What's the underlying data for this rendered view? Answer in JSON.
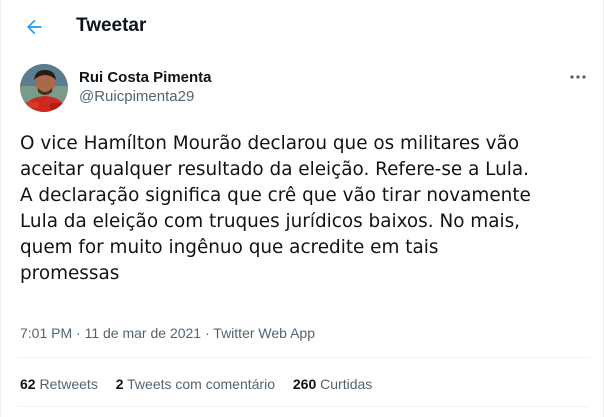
{
  "header": {
    "title": "Tweetar",
    "back_icon": "arrow-left-icon"
  },
  "colors": {
    "accent": "#1d9bf0",
    "secondary_text": "#536471",
    "primary_text": "#0f1419"
  },
  "tweet": {
    "author_name": "Rui Costa Pimenta",
    "author_handle": "@Ruicpimenta29",
    "more_icon": "more-dots-icon",
    "text": "O vice Hamílton Mourão declarou que os militares vão\naceitar qualquer resultado da eleição. Refere-se a Lula.\nA declaração significa que crê que vão tirar novamente\nLula da eleição com truques jurídicos baixos. No mais,\nquem for muito ingênuo que acredite em tais\npromessas",
    "time": "7:01 PM",
    "separator": " · ",
    "date": "11 de mar de 2021",
    "source": "Twitter Web App"
  },
  "stats": {
    "retweets_count": "62",
    "retweets_label": " Retweets",
    "comments_count": "2",
    "comments_label": " Tweets com comentário",
    "likes_count": "260",
    "likes_label": " Curtidas"
  }
}
